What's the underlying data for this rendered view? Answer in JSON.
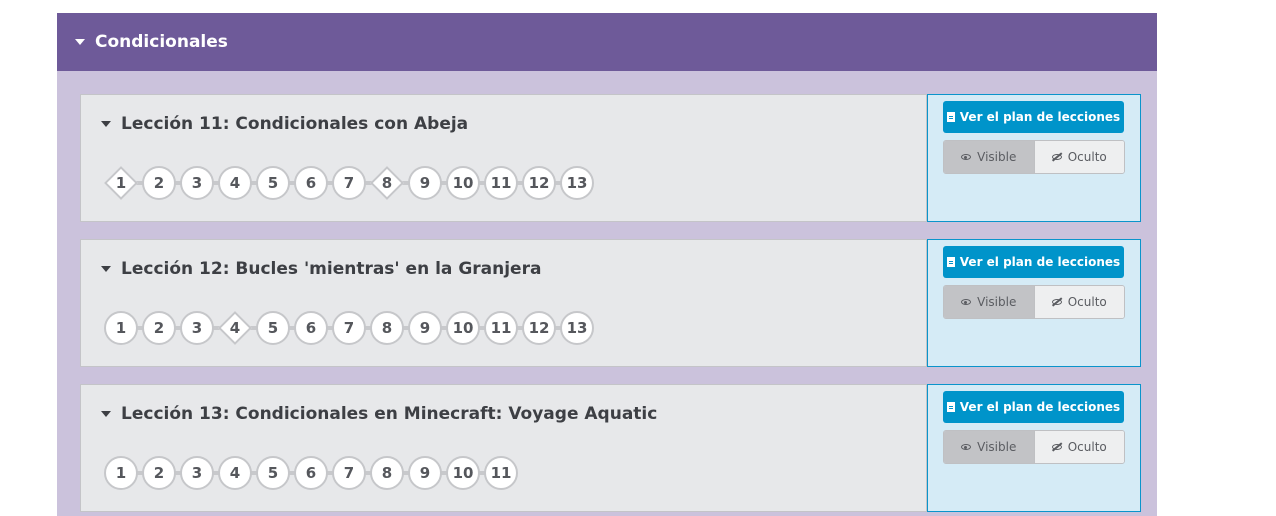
{
  "unit": {
    "title": "Condicionales",
    "accent_color": "#6e5a99",
    "lessons": [
      {
        "title": "Lección 11: Condicionales con Abeja",
        "levels": [
          "1",
          "2",
          "3",
          "4",
          "5",
          "6",
          "7",
          "8",
          "9",
          "10",
          "11",
          "12",
          "13"
        ],
        "diamond_levels": [
          "1",
          "8"
        ],
        "plan_label": "Ver el plan de lecciones",
        "visible_label": "Visible",
        "hidden_label": "Oculto"
      },
      {
        "title": "Lección 12: Bucles 'mientras' en la Granjera",
        "levels": [
          "1",
          "2",
          "3",
          "4",
          "5",
          "6",
          "7",
          "8",
          "9",
          "10",
          "11",
          "12",
          "13"
        ],
        "diamond_levels": [
          "4"
        ],
        "plan_label": "Ver el plan de lecciones",
        "visible_label": "Visible",
        "hidden_label": "Oculto"
      },
      {
        "title": "Lección 13: Condicionales en Minecraft: Voyage Aquatic",
        "levels": [
          "1",
          "2",
          "3",
          "4",
          "5",
          "6",
          "7",
          "8",
          "9",
          "10",
          "11"
        ],
        "diamond_levels": [],
        "plan_label": "Ver el plan de lecciones",
        "visible_label": "Visible",
        "hidden_label": "Oculto"
      }
    ]
  }
}
